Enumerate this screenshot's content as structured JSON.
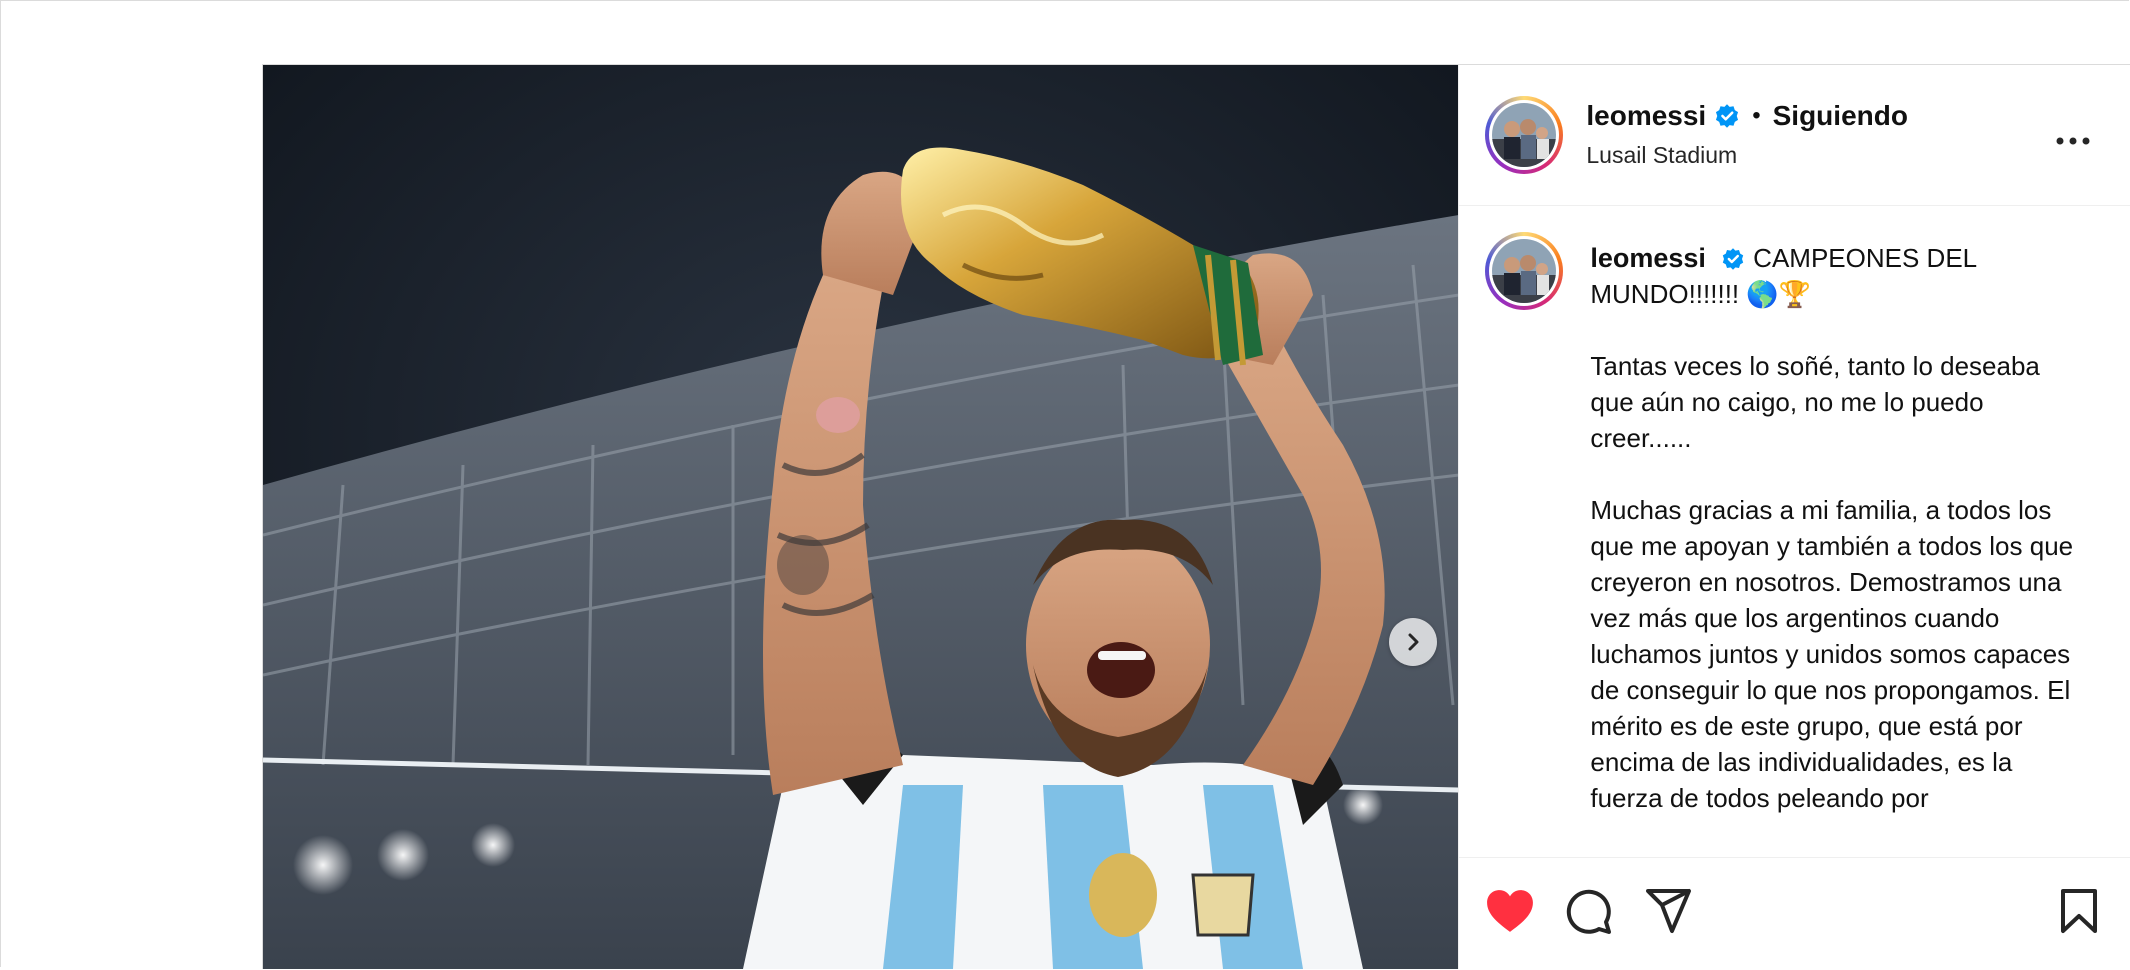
{
  "post": {
    "author": {
      "username": "leomessi",
      "verified_icon": "verified-badge-icon",
      "following_label": "Siguiendo",
      "separator": "•",
      "location": "Lusail Stadium"
    },
    "more_icon": "more-options-icon",
    "media": {
      "description_icon": "photo",
      "next_icon": "chevron-right-icon"
    },
    "caption": {
      "username": "leomessi",
      "headline": "CAMPEONES DEL MUNDO!!!!!!! 🌎🏆",
      "body": "\nTantas veces lo soñé, tanto lo deseaba que aún no caigo, no me lo puedo creer......\n\nMuchas gracias a mi familia, a todos los que me apoyan y también a todos los que creyeron en nosotros. Demostramos una vez más que los argentinos cuando luchamos juntos y unidos somos capaces de conseguir lo que nos propongamos. El mérito es de este grupo, que está por encima de las individualidades, es la fuerza de todos peleando por"
    },
    "actions": {
      "like_icon": "heart-filled-icon",
      "comment_icon": "comment-icon",
      "share_icon": "send-icon",
      "save_icon": "bookmark-icon"
    }
  },
  "colors": {
    "like": "#ff3040",
    "verified": "#0095f6",
    "text": "#111111",
    "border": "#dbdbdb"
  }
}
